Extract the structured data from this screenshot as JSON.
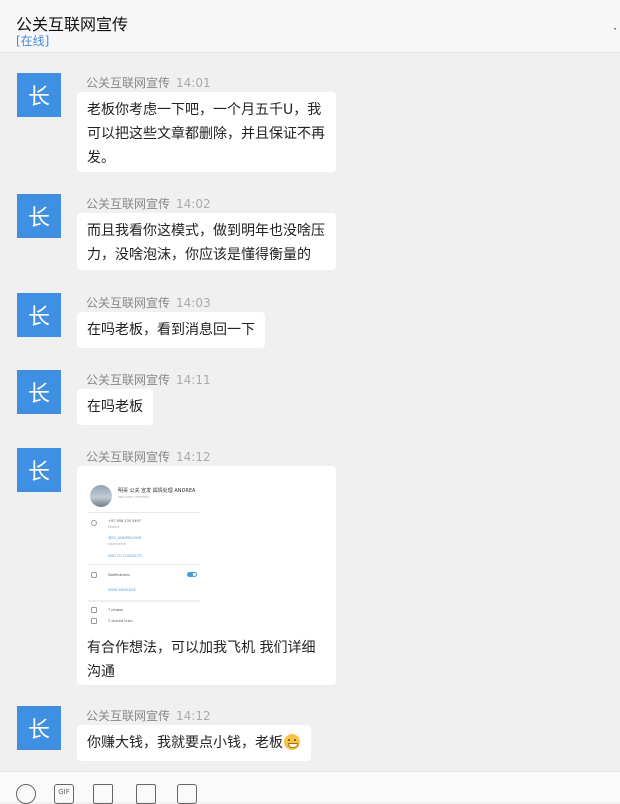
{
  "header": {
    "title": "公关互联网宣传",
    "status": "[在线]"
  },
  "avatar_char": "长",
  "messages": [
    {
      "sender": "公关互联网宣传",
      "time": "14:01",
      "lines": [
        "老板你考虑一下吧，一个月五千U，我",
        "可以把这些文章都删除，并且保证不再",
        "发。"
      ]
    },
    {
      "sender": "公关互联网宣传",
      "time": "14:02",
      "lines": [
        "而且我看你这模式，做到明年也没啥压",
        "力，没啥泡沫，你应该是懂得衡量的"
      ]
    },
    {
      "sender": "公关互联网宣传",
      "time": "14:03",
      "lines": [
        "在吗老板，看到消息回一下"
      ]
    },
    {
      "sender": "公关互联网宣传",
      "time": "14:11",
      "lines": [
        "在吗老板"
      ]
    },
    {
      "sender": "公关互联网宣传",
      "time": "14:12",
      "lines": [
        "有合作想法，可以加我飞机 我们详细",
        "沟通"
      ],
      "image": {
        "name": "明哥 公关 宣发 舆情处理 ANDREA",
        "subtitle": "last seen recently",
        "phone": "+97 958 135 5497",
        "phone_label": "Mobile",
        "username": "@FU_ANDREA2008",
        "username_label": "Username",
        "add_contacts": "ADD TO CONTACTS",
        "notifications": "Notifications",
        "send_message": "SEND MESSAGE",
        "photos": "7 photos",
        "links": "2 shared links"
      }
    },
    {
      "sender": "公关互联网宣传",
      "time": "14:12",
      "text": "你赚大钱，我就要点小钱，老板"
    }
  ],
  "toolbar": {
    "icons": [
      "emoji-icon",
      "gif-icon",
      "image-icon",
      "file-icon",
      "video-icon"
    ],
    "gif_label": "GIF"
  }
}
